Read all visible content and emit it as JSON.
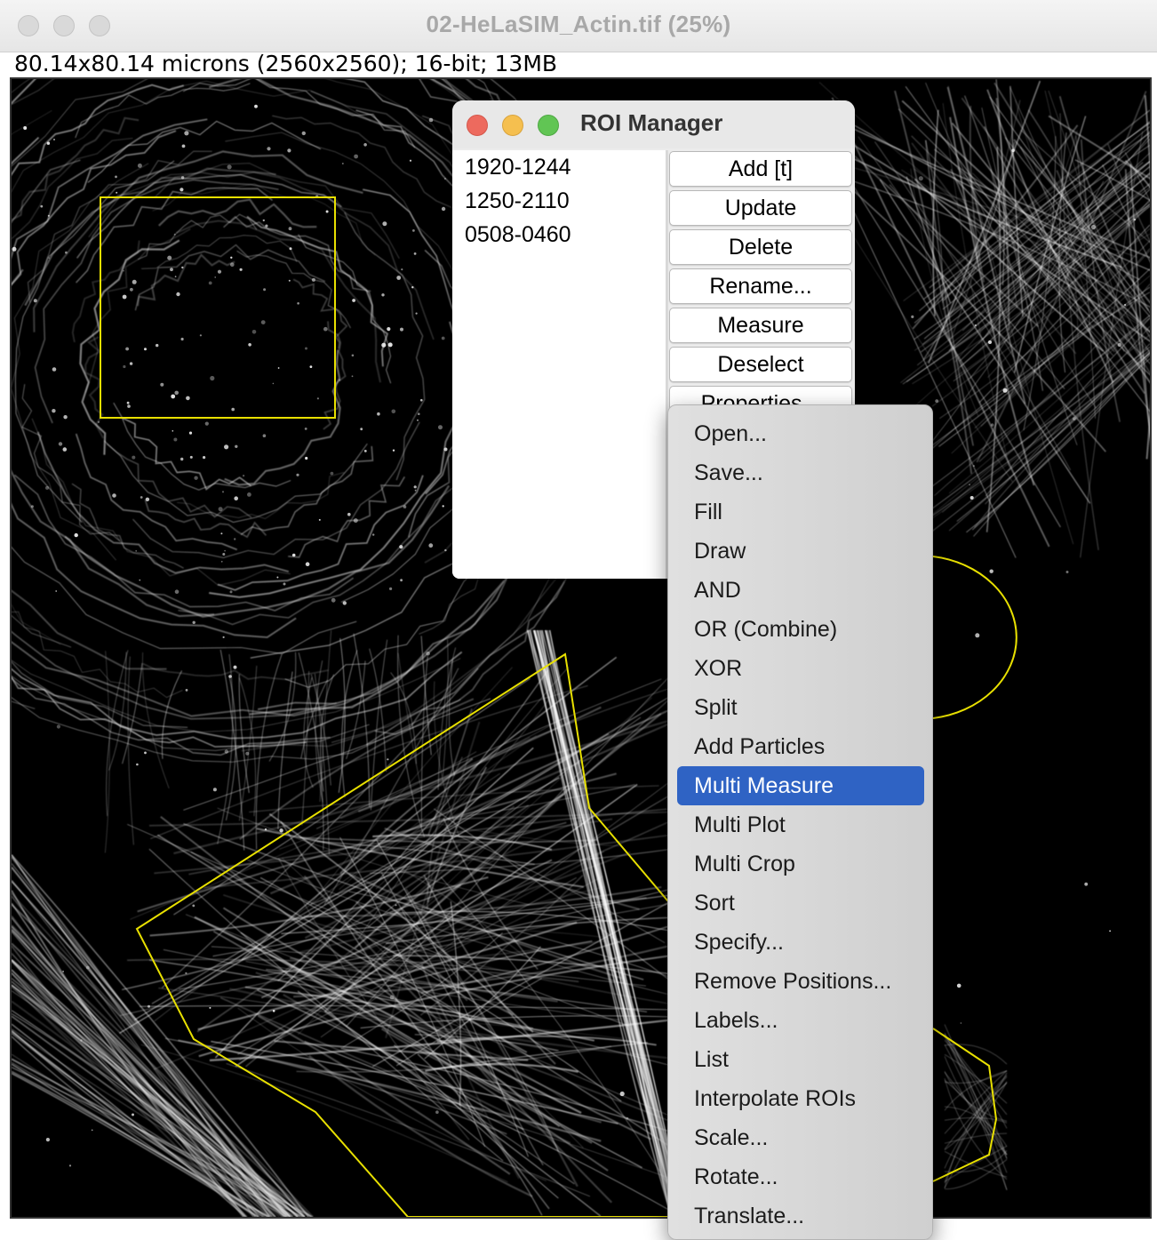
{
  "image_window": {
    "title": "02-HeLaSIM_Actin.tif (25%)",
    "info": "80.14x80.14 microns (2560x2560); 16-bit; 13MB"
  },
  "roi_manager": {
    "title": "ROI Manager",
    "rois": [
      "1920-1244",
      "1250-2110",
      "0508-0460"
    ],
    "buttons": [
      "Add [t]",
      "Update",
      "Delete",
      "Rename...",
      "Measure",
      "Deselect",
      "Properties..."
    ],
    "traffic_colors": {
      "close": "#ed6a5e",
      "minimize": "#f5bf4f",
      "zoom": "#61c554"
    }
  },
  "context_menu": {
    "items": [
      "Open...",
      "Save...",
      "Fill",
      "Draw",
      "AND",
      "OR (Combine)",
      "XOR",
      "Split",
      "Add Particles",
      "Multi Measure",
      "Multi Plot",
      "Multi Crop",
      "Sort",
      "Specify...",
      "Remove Positions...",
      "Labels...",
      "List",
      "Interpolate ROIs",
      "Scale...",
      "Rotate...",
      "Translate..."
    ],
    "highlighted": "Multi Measure",
    "highlight_color": "#2f63c4"
  },
  "roi_overlay_color": "#e8e000"
}
